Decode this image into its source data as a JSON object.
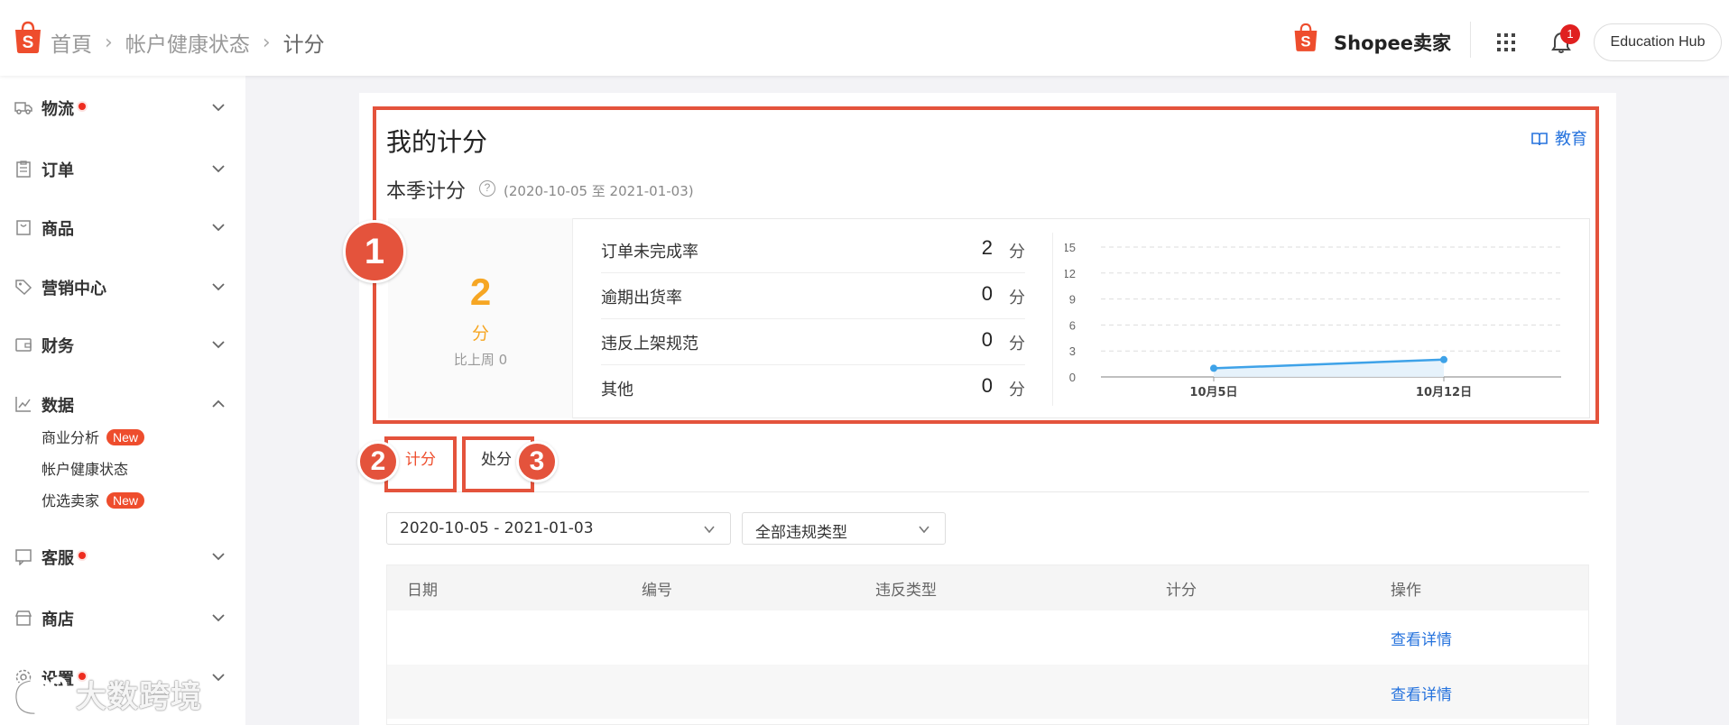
{
  "header": {
    "breadcrumbs": [
      "首頁",
      "帐户健康状态",
      "计分"
    ],
    "separator": "›",
    "brand": "Shopee卖家",
    "notification_count": "1",
    "education_hub": "Education Hub",
    "brand_color": "#ee4d2d"
  },
  "sidebar": {
    "items": [
      {
        "label": "物流",
        "icon": "truck-icon",
        "dot": true
      },
      {
        "label": "订单",
        "icon": "clipboard-icon",
        "dot": false
      },
      {
        "label": "商品",
        "icon": "product-bag-icon",
        "dot": false
      },
      {
        "label": "营销中心",
        "icon": "tag-icon",
        "dot": false
      },
      {
        "label": "财务",
        "icon": "wallet-icon",
        "dot": false
      },
      {
        "label": "数据",
        "icon": "chart-icon",
        "dot": false,
        "expanded": true
      },
      {
        "label": "客服",
        "icon": "chat-icon",
        "dot": true
      },
      {
        "label": "商店",
        "icon": "store-icon",
        "dot": false
      },
      {
        "label": "设置",
        "icon": "gear-icon",
        "dot": true
      }
    ],
    "data_subitems": [
      {
        "label": "商业分析",
        "badge": "New"
      },
      {
        "label": "帐户健康状态",
        "badge": ""
      },
      {
        "label": "优选卖家",
        "badge": "New"
      }
    ]
  },
  "score_section": {
    "title": "我的计分",
    "education_link": "教育",
    "season_title": "本季计分",
    "season_range": "(2020-10-05 至 2021-01-03)",
    "total_score": "2",
    "total_unit": "分",
    "compare_text": "比上周 0",
    "metrics": [
      {
        "label": "订单未完成率",
        "value": "2",
        "unit": "分"
      },
      {
        "label": "逾期出货率",
        "value": "0",
        "unit": "分"
      },
      {
        "label": "违反上架规范",
        "value": "0",
        "unit": "分"
      },
      {
        "label": "其他",
        "value": "0",
        "unit": "分"
      }
    ]
  },
  "chart_data": {
    "type": "line",
    "categories": [
      "10月5日",
      "10月12日"
    ],
    "series": [
      {
        "values": [
          1,
          2
        ]
      }
    ],
    "y_ticks": [
      0,
      3,
      6,
      9,
      12,
      15
    ],
    "ylim": [
      0,
      15
    ],
    "grid": true,
    "line_color": "#3ea2e8"
  },
  "annotations": [
    "1",
    "2",
    "3"
  ],
  "tabs": [
    {
      "label": "计分",
      "active": true
    },
    {
      "label": "处分",
      "active": false
    }
  ],
  "filters": {
    "date_range": "2020-10-05 - 2021-01-03",
    "violation_type": "全部违规类型"
  },
  "table": {
    "columns": [
      "日期",
      "编号",
      "违反类型",
      "计分",
      "操作"
    ],
    "rows": [
      {
        "date": "",
        "id": "",
        "type": "",
        "score": "",
        "action": "查看详情"
      },
      {
        "date": "",
        "id": "",
        "type": "",
        "score": "",
        "action": "查看详情"
      }
    ]
  },
  "watermark": "大数跨境"
}
